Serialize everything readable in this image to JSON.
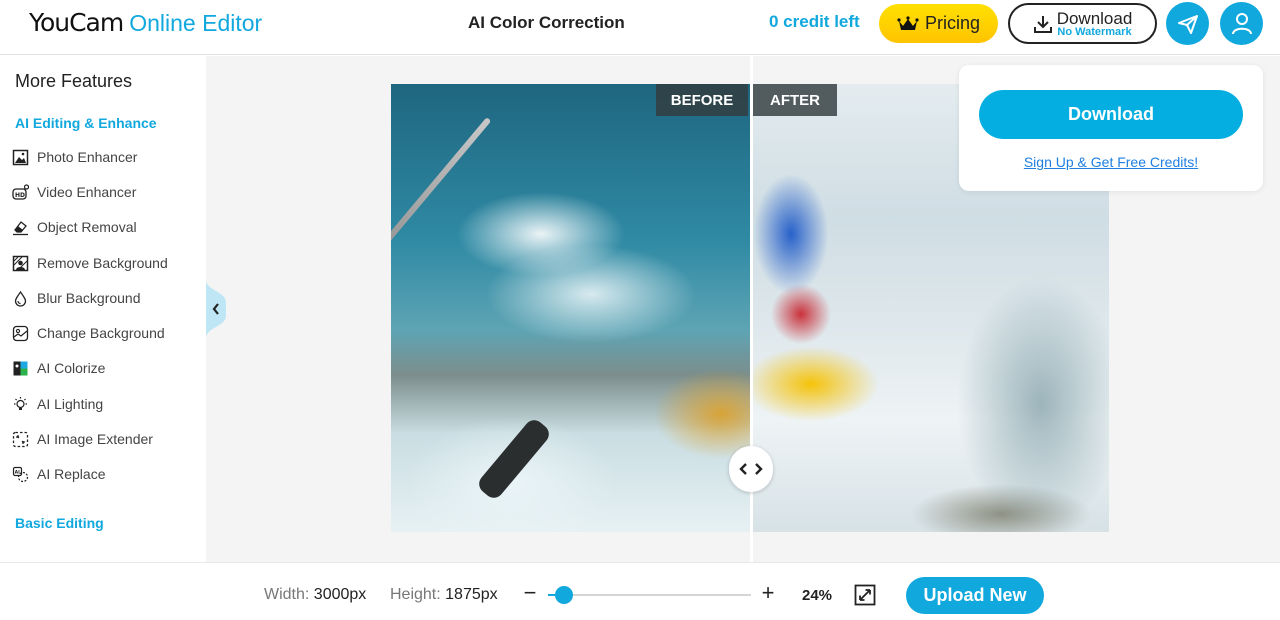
{
  "header": {
    "logo_brand": "YouCam",
    "logo_sub": "Online Editor",
    "page_title": "AI Color Correction",
    "credits": "0 credit left",
    "pricing_label": "Pricing",
    "download_label": "Download",
    "download_sub": "No Watermark",
    "icons": {
      "pricing": "crown-icon",
      "download": "download-icon",
      "share": "paper-plane-icon",
      "account": "user-icon"
    }
  },
  "sidebar": {
    "title": "More Features",
    "categories": [
      {
        "label": "AI Editing & Enhance",
        "items": [
          {
            "label": "Photo Enhancer",
            "icon": "photo-enhancer-icon"
          },
          {
            "label": "Video Enhancer",
            "icon": "hd-video-icon"
          },
          {
            "label": "Object Removal",
            "icon": "eraser-icon"
          },
          {
            "label": "Remove Background",
            "icon": "remove-bg-icon"
          },
          {
            "label": "Blur Background",
            "icon": "droplet-icon"
          },
          {
            "label": "Change Background",
            "icon": "image-icon"
          },
          {
            "label": "AI Colorize",
            "icon": "colorize-icon"
          },
          {
            "label": "AI Lighting",
            "icon": "lightbulb-icon"
          },
          {
            "label": "AI Image Extender",
            "icon": "expand-icon"
          },
          {
            "label": "AI Replace",
            "icon": "ai-replace-icon"
          }
        ]
      },
      {
        "label": "Basic Editing",
        "items": []
      }
    ]
  },
  "compare": {
    "before_label": "BEFORE",
    "after_label": "AFTER",
    "split_fraction": 0.5
  },
  "popup": {
    "download_label": "Download",
    "signup_link": "Sign Up & Get Free Credits!"
  },
  "bottombar": {
    "width_key": "Width:",
    "width_val": "3000px",
    "height_key": "Height:",
    "height_val": "1875px",
    "minus": "−",
    "plus": "+",
    "zoom_fraction": 0.08,
    "zoom_label": "24%",
    "upload_label": "Upload New"
  },
  "colors": {
    "accent": "#11a8de",
    "pricing": "#ffd000",
    "link": "#1f7fe0"
  }
}
